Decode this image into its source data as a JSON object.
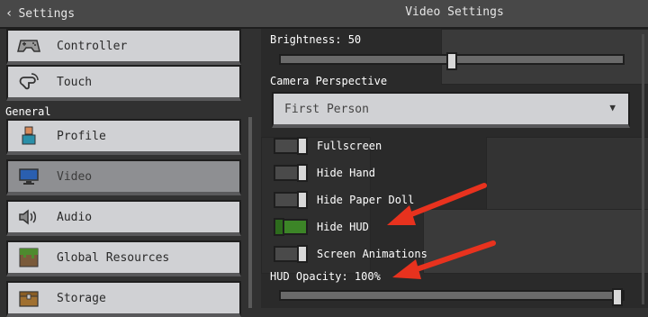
{
  "header": {
    "back_label": "Settings",
    "title": "Video Settings"
  },
  "sidebar": {
    "section_label": "General",
    "items": [
      {
        "label": "Controller",
        "icon": "controller-icon",
        "selected": false
      },
      {
        "label": "Touch",
        "icon": "touch-icon",
        "selected": false
      },
      {
        "label": "Profile",
        "icon": "profile-icon",
        "selected": false
      },
      {
        "label": "Video",
        "icon": "monitor-icon",
        "selected": true
      },
      {
        "label": "Audio",
        "icon": "speaker-icon",
        "selected": false
      },
      {
        "label": "Global Resources",
        "icon": "grass-block-icon",
        "selected": false
      },
      {
        "label": "Storage",
        "icon": "chest-icon",
        "selected": false
      }
    ]
  },
  "settings": {
    "brightness": {
      "label": "Brightness: 50",
      "value": 50,
      "max": 100
    },
    "camera_perspective": {
      "label": "Camera Perspective",
      "selected": "First Person"
    },
    "toggles": [
      {
        "label": "Fullscreen",
        "on": false
      },
      {
        "label": "Hide Hand",
        "on": false
      },
      {
        "label": "Hide Paper Doll",
        "on": false
      },
      {
        "label": "Hide HUD",
        "on": true
      },
      {
        "label": "Screen Animations",
        "on": false
      }
    ],
    "hud_opacity": {
      "label": "HUD Opacity: 100%",
      "value": 100,
      "max": 100
    }
  },
  "colors": {
    "toggle_on": "#3c8527",
    "annotation_arrow": "#e8321e"
  }
}
